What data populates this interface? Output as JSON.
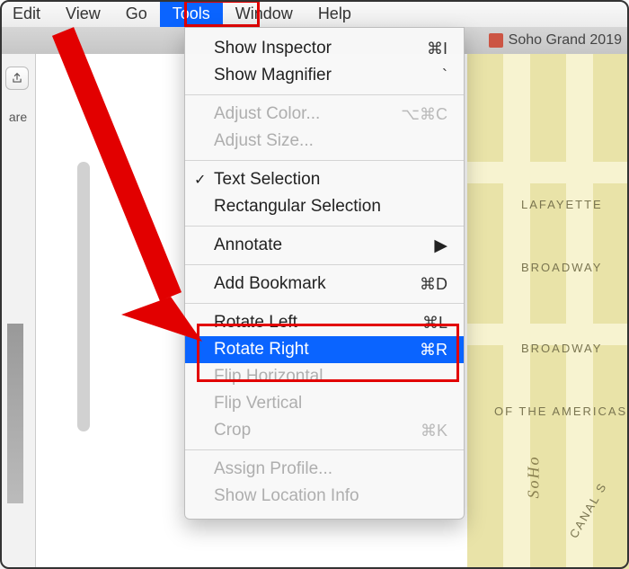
{
  "menubar": {
    "items": [
      {
        "label": "Edit"
      },
      {
        "label": "View"
      },
      {
        "label": "Go"
      },
      {
        "label": "Tools"
      },
      {
        "label": "Window"
      },
      {
        "label": "Help"
      }
    ],
    "selected_index": 3
  },
  "tab": {
    "label": "Soho Grand 2019"
  },
  "sidebar": {
    "share_label": "are"
  },
  "dropdown": {
    "items": [
      {
        "label": "Show Inspector",
        "shortcut": "⌘I"
      },
      {
        "label": "Show Magnifier",
        "shortcut": "`"
      },
      {
        "type": "sep"
      },
      {
        "label": "Adjust Color...",
        "shortcut": "⌥⌘C",
        "disabled": true
      },
      {
        "label": "Adjust Size...",
        "disabled": true
      },
      {
        "type": "sep"
      },
      {
        "label": "Text Selection",
        "checked": true
      },
      {
        "label": "Rectangular Selection"
      },
      {
        "type": "sep"
      },
      {
        "label": "Annotate",
        "submenu": true
      },
      {
        "type": "sep"
      },
      {
        "label": "Add Bookmark",
        "shortcut": "⌘D"
      },
      {
        "type": "sep"
      },
      {
        "label": "Rotate Left",
        "shortcut": "⌘L"
      },
      {
        "label": "Rotate Right",
        "shortcut": "⌘R",
        "highlight": true
      },
      {
        "label": "Flip Horizontal",
        "disabled": true
      },
      {
        "label": "Flip Vertical",
        "disabled": true
      },
      {
        "label": "Crop",
        "shortcut": "⌘K",
        "disabled": true
      },
      {
        "type": "sep"
      },
      {
        "label": "Assign Profile...",
        "disabled": true
      },
      {
        "label": "Show Location Info",
        "disabled": true
      }
    ]
  },
  "map": {
    "streets": [
      "LAFAYETTE",
      "BROADWAY",
      "BROADWAY",
      "OF THE AMERICAS",
      "SoHo",
      "CANAL S"
    ]
  },
  "annotations": {
    "tools_highlight": true,
    "rotate_box": true,
    "arrow": true
  }
}
